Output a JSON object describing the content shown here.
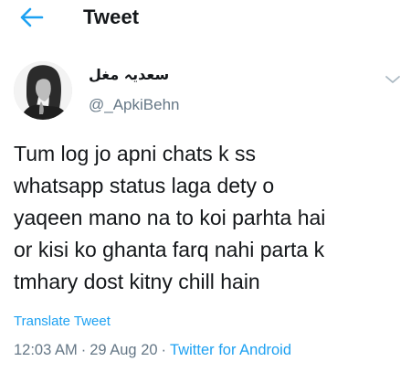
{
  "header": {
    "title": "Tweet",
    "back_icon": "arrow-left-icon",
    "accent": "#1da1f2"
  },
  "tweet": {
    "author": {
      "display_name": "سعدیہ مغل",
      "handle": "@_ApkiBehn"
    },
    "more_icon": "chevron-down-icon",
    "text": "Tum log jo apni chats k ss\nwhatsapp status laga dety o\nyaqeen mano na to koi parhta hai\nor kisi ko ghanta farq nahi parta k\ntmhary dost kitny chill hain",
    "translate_label": "Translate Tweet",
    "time": "12:03 AM",
    "separator": "·",
    "date": "29 Aug 20",
    "source": "Twitter for Android"
  },
  "colors": {
    "text": "#14171a",
    "secondary": "#657786",
    "link": "#1da1f2",
    "background": "#ffffff"
  }
}
